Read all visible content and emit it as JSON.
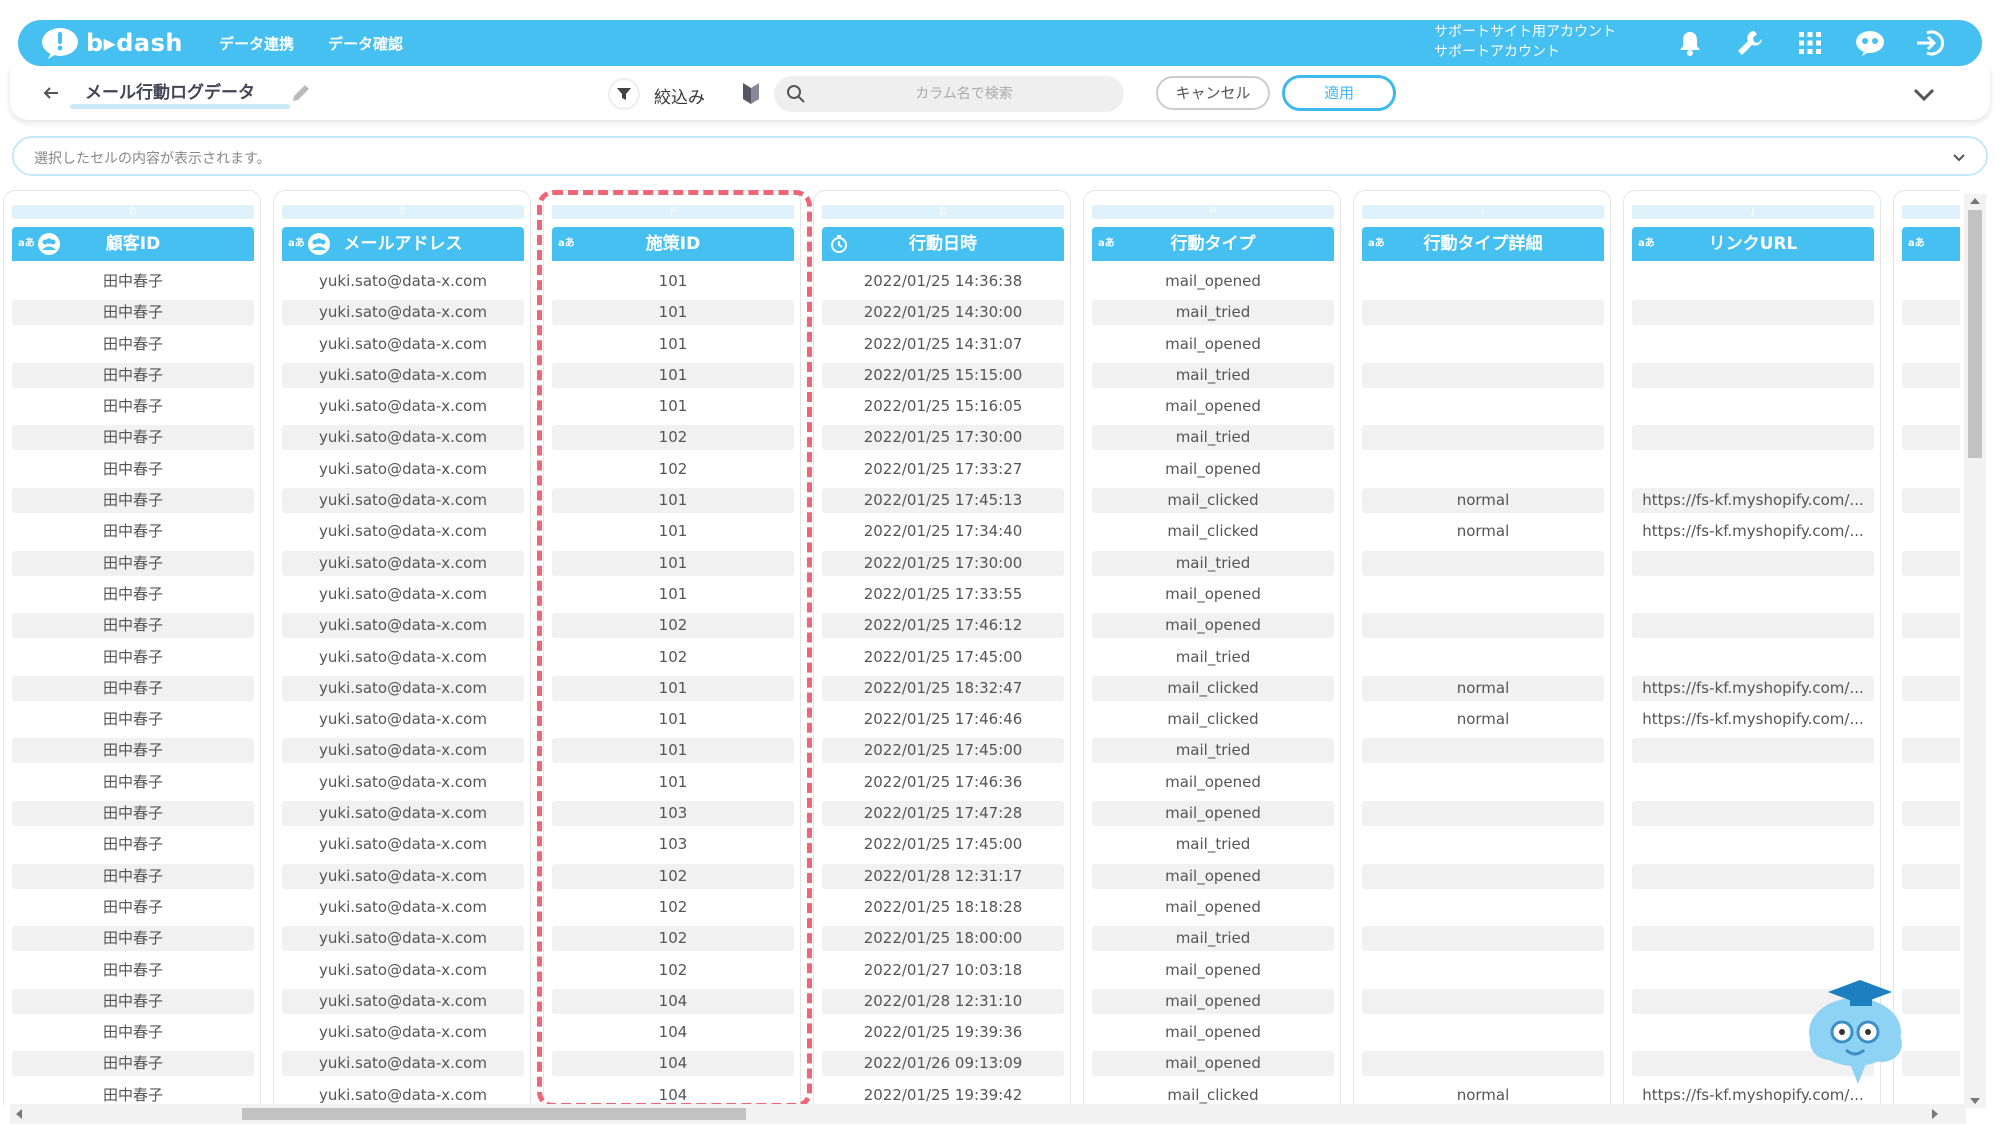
{
  "brand": {
    "logo_text": "b▸dash",
    "accent": "#45c0f0",
    "highlight": "#ee6677"
  },
  "topbar": {
    "nav": [
      "データ連携",
      "データ確認"
    ],
    "account_line1": "サポートサイト用アカウント",
    "account_line2": "サポートアカウント",
    "icons": [
      "bell-icon",
      "wrench-icon",
      "grid-apps-icon",
      "chat-mascot-icon",
      "logout-icon"
    ]
  },
  "titlebar": {
    "title": "メール行動ログデータ",
    "filter_label": "絞込み",
    "search_placeholder": "カラム名で検索",
    "cancel_label": "キャンセル",
    "apply_label": "適用"
  },
  "cellbar": {
    "placeholder": "選択したセルの内容が表示されます。"
  },
  "columns": [
    {
      "letter": "D",
      "name": "顧客ID",
      "type": "aあ",
      "key": true
    },
    {
      "letter": "E",
      "name": "メールアドレス",
      "type": "aあ",
      "key": true
    },
    {
      "letter": "F",
      "name": "施策ID",
      "type": "aあ",
      "key": false
    },
    {
      "letter": "G",
      "name": "行動日時",
      "type": "clock",
      "key": false
    },
    {
      "letter": "H",
      "name": "行動タイプ",
      "type": "aあ",
      "key": false
    },
    {
      "letter": "I",
      "name": "行動タイプ詳細",
      "type": "aあ",
      "key": false
    },
    {
      "letter": "J",
      "name": "リンクURL",
      "type": "aあ",
      "key": false
    },
    {
      "letter": "",
      "name": "",
      "type": "aあ",
      "key": false
    }
  ],
  "rows": [
    [
      "田中春子",
      "yuki.sato@data-x.com",
      "101",
      "2022/01/25 14:36:38",
      "mail_opened",
      "",
      ""
    ],
    [
      "田中春子",
      "yuki.sato@data-x.com",
      "101",
      "2022/01/25 14:30:00",
      "mail_tried",
      "",
      ""
    ],
    [
      "田中春子",
      "yuki.sato@data-x.com",
      "101",
      "2022/01/25 14:31:07",
      "mail_opened",
      "",
      ""
    ],
    [
      "田中春子",
      "yuki.sato@data-x.com",
      "101",
      "2022/01/25 15:15:00",
      "mail_tried",
      "",
      ""
    ],
    [
      "田中春子",
      "yuki.sato@data-x.com",
      "101",
      "2022/01/25 15:16:05",
      "mail_opened",
      "",
      ""
    ],
    [
      "田中春子",
      "yuki.sato@data-x.com",
      "102",
      "2022/01/25 17:30:00",
      "mail_tried",
      "",
      ""
    ],
    [
      "田中春子",
      "yuki.sato@data-x.com",
      "102",
      "2022/01/25 17:33:27",
      "mail_opened",
      "",
      ""
    ],
    [
      "田中春子",
      "yuki.sato@data-x.com",
      "101",
      "2022/01/25 17:45:13",
      "mail_clicked",
      "normal",
      "https://fs-kf.myshopify.com/..."
    ],
    [
      "田中春子",
      "yuki.sato@data-x.com",
      "101",
      "2022/01/25 17:34:40",
      "mail_clicked",
      "normal",
      "https://fs-kf.myshopify.com/..."
    ],
    [
      "田中春子",
      "yuki.sato@data-x.com",
      "101",
      "2022/01/25 17:30:00",
      "mail_tried",
      "",
      ""
    ],
    [
      "田中春子",
      "yuki.sato@data-x.com",
      "101",
      "2022/01/25 17:33:55",
      "mail_opened",
      "",
      ""
    ],
    [
      "田中春子",
      "yuki.sato@data-x.com",
      "102",
      "2022/01/25 17:46:12",
      "mail_opened",
      "",
      ""
    ],
    [
      "田中春子",
      "yuki.sato@data-x.com",
      "102",
      "2022/01/25 17:45:00",
      "mail_tried",
      "",
      ""
    ],
    [
      "田中春子",
      "yuki.sato@data-x.com",
      "101",
      "2022/01/25 18:32:47",
      "mail_clicked",
      "normal",
      "https://fs-kf.myshopify.com/..."
    ],
    [
      "田中春子",
      "yuki.sato@data-x.com",
      "101",
      "2022/01/25 17:46:46",
      "mail_clicked",
      "normal",
      "https://fs-kf.myshopify.com/..."
    ],
    [
      "田中春子",
      "yuki.sato@data-x.com",
      "101",
      "2022/01/25 17:45:00",
      "mail_tried",
      "",
      ""
    ],
    [
      "田中春子",
      "yuki.sato@data-x.com",
      "101",
      "2022/01/25 17:46:36",
      "mail_opened",
      "",
      ""
    ],
    [
      "田中春子",
      "yuki.sato@data-x.com",
      "103",
      "2022/01/25 17:47:28",
      "mail_opened",
      "",
      ""
    ],
    [
      "田中春子",
      "yuki.sato@data-x.com",
      "103",
      "2022/01/25 17:45:00",
      "mail_tried",
      "",
      ""
    ],
    [
      "田中春子",
      "yuki.sato@data-x.com",
      "102",
      "2022/01/28 12:31:17",
      "mail_opened",
      "",
      ""
    ],
    [
      "田中春子",
      "yuki.sato@data-x.com",
      "102",
      "2022/01/25 18:18:28",
      "mail_opened",
      "",
      ""
    ],
    [
      "田中春子",
      "yuki.sato@data-x.com",
      "102",
      "2022/01/25 18:00:00",
      "mail_tried",
      "",
      ""
    ],
    [
      "田中春子",
      "yuki.sato@data-x.com",
      "102",
      "2022/01/27 10:03:18",
      "mail_opened",
      "",
      ""
    ],
    [
      "田中春子",
      "yuki.sato@data-x.com",
      "104",
      "2022/01/28 12:31:10",
      "mail_opened",
      "",
      ""
    ],
    [
      "田中春子",
      "yuki.sato@data-x.com",
      "104",
      "2022/01/25 19:39:36",
      "mail_opened",
      "",
      ""
    ],
    [
      "田中春子",
      "yuki.sato@data-x.com",
      "104",
      "2022/01/26 09:13:09",
      "mail_opened",
      "",
      ""
    ],
    [
      "田中春子",
      "yuki.sato@data-x.com",
      "104",
      "2022/01/25 19:39:42",
      "mail_clicked",
      "normal",
      "https://fs-kf.myshopify.com/..."
    ]
  ]
}
